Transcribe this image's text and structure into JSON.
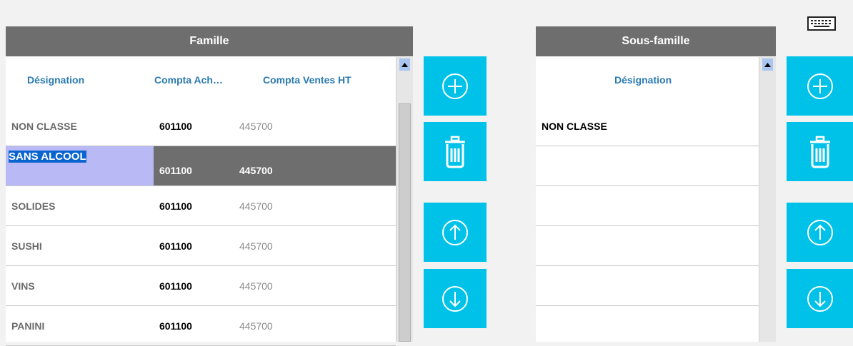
{
  "famille": {
    "title": "Famille",
    "columns": [
      "Désignation",
      "Compta Ach…",
      "Compta Ventes HT"
    ],
    "rows": [
      {
        "designation": "NON CLASSE",
        "achat": "601100",
        "ventes": "445700"
      },
      {
        "designation": "SANS ALCOOL",
        "achat": "601100",
        "ventes": "445700"
      },
      {
        "designation": "SOLIDES",
        "achat": "601100",
        "ventes": "445700"
      },
      {
        "designation": "SUSHI",
        "achat": "601100",
        "ventes": "445700"
      },
      {
        "designation": "VINS",
        "achat": "601100",
        "ventes": "445700"
      },
      {
        "designation": "PANINI",
        "achat": "601100",
        "ventes": "445700"
      }
    ],
    "selected_row_index": 1
  },
  "sous_famille": {
    "title": "Sous-famille",
    "columns": [
      "Désignation"
    ],
    "rows": [
      {
        "designation": "NON CLASSE"
      },
      {
        "designation": ""
      },
      {
        "designation": ""
      },
      {
        "designation": ""
      },
      {
        "designation": ""
      }
    ]
  },
  "colors": {
    "header_bg": "#6e6e6e",
    "column_header_text": "#2a7ab0",
    "button_bg": "#00c2e8",
    "selection_bg": "#6e6e6e",
    "edit_highlight": "#b9b9f5",
    "text_selection": "#0a64d0"
  },
  "icons": {
    "add": "plus-circle-icon",
    "delete": "trash-icon",
    "up": "arrow-up-circle-icon",
    "down": "arrow-down-circle-icon",
    "keyboard": "keyboard-icon"
  }
}
